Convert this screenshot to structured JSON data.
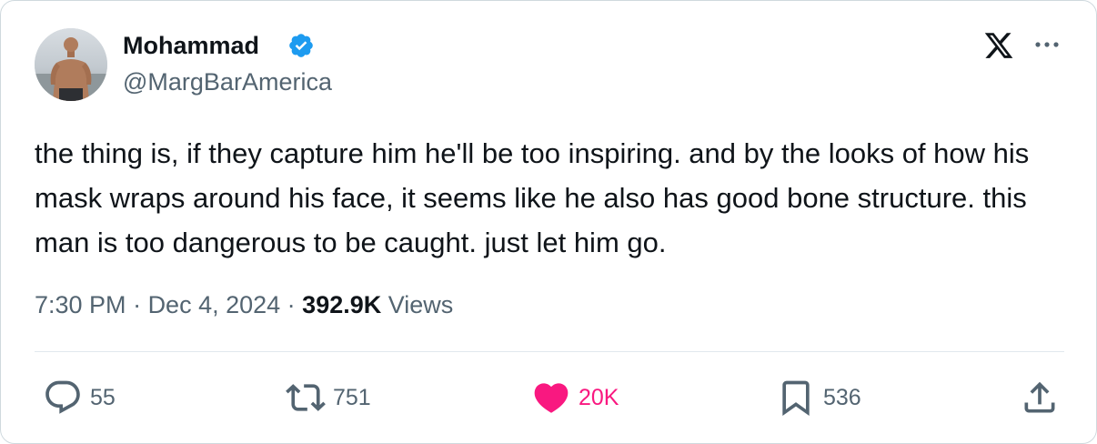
{
  "author": {
    "name": "Mohammad",
    "handle": "@MargBarAmerica",
    "verified": true
  },
  "header_icons": [
    "x-logo-icon",
    "more-icon"
  ],
  "tweet": {
    "text": "the thing is, if they capture him he'll be too inspiring. and by the looks of how his mask wraps around his face, it seems like he also has good bone structure. this man is too dangerous to be caught. just let him go."
  },
  "meta": {
    "time": "7:30 PM",
    "separator1": " · ",
    "date": "Dec 4, 2024",
    "separator2": " · ",
    "views_count": "392.9K",
    "views_label": " Views"
  },
  "actions": {
    "replies": "55",
    "reposts": "751",
    "likes": "20K",
    "bookmarks": "536"
  },
  "colors": {
    "verified_blue": "#1d9bf0",
    "like_pink": "#f91880",
    "secondary_text": "#536471",
    "primary_text": "#0f1419"
  }
}
